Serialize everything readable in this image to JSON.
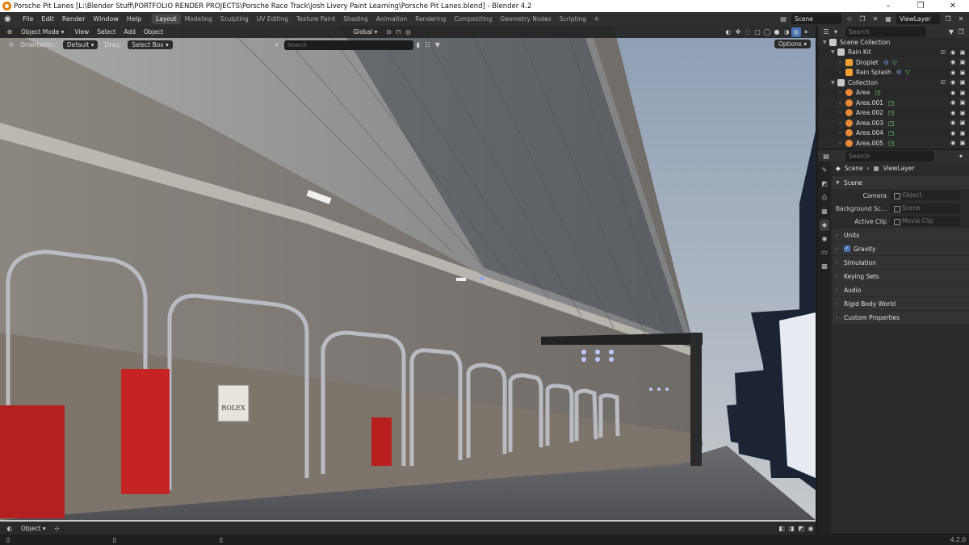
{
  "window": {
    "title": "Porsche Pit Lanes [L:\\Blender Stuff\\PORTFOLIO RENDER PROJECTS\\Porsche Race Track\\Josh Livery Paint Learning\\Porsche Pit Lanes.blend] - Blender 4.2",
    "minimize": "–",
    "maximize": "❐",
    "close": "✕"
  },
  "menu": [
    "File",
    "Edit",
    "Render",
    "Window",
    "Help"
  ],
  "workspaces": [
    {
      "label": "Layout",
      "active": true
    },
    {
      "label": "Modeling"
    },
    {
      "label": "Sculpting"
    },
    {
      "label": "UV Editing"
    },
    {
      "label": "Texture Paint"
    },
    {
      "label": "Shading"
    },
    {
      "label": "Animation"
    },
    {
      "label": "Rendering"
    },
    {
      "label": "Compositing"
    },
    {
      "label": "Geometry Nodes"
    },
    {
      "label": "Scripting"
    }
  ],
  "topbar_right": {
    "scene": "Scene",
    "view_layer": "ViewLayer"
  },
  "viewport": {
    "mode": "Object Mode",
    "menus": [
      "View",
      "Select",
      "Add",
      "Object"
    ],
    "transform_orientation": "Global",
    "orientation_label": "Orientation:",
    "orientation_value": "Default",
    "drag_label": "Drag:",
    "drag_value": "Select Box",
    "search_placeholder": "Search",
    "options": "Options"
  },
  "outliner": {
    "search_placeholder": "Search",
    "items": [
      {
        "name": "Scene Collection",
        "indent": 0,
        "icon": "collection-icon",
        "color": "#c8c8c8"
      },
      {
        "name": "Rain Kit",
        "indent": 1,
        "icon": "collection-icon",
        "color": "#c8c8c8",
        "checked": true
      },
      {
        "name": "Droplet",
        "indent": 2,
        "icon": "mesh-icon",
        "color": "#f0a030",
        "extra": true
      },
      {
        "name": "Rain Splash",
        "indent": 2,
        "icon": "mesh-icon",
        "color": "#f0a030",
        "extra": true
      },
      {
        "name": "Collection",
        "indent": 1,
        "icon": "collection-icon",
        "color": "#c8c8c8",
        "checked": true
      },
      {
        "name": "Area",
        "indent": 2,
        "icon": "light-icon",
        "color": "#e8893a",
        "data": true
      },
      {
        "name": "Area.001",
        "indent": 2,
        "icon": "light-icon",
        "color": "#e8893a",
        "data": true
      },
      {
        "name": "Area.002",
        "indent": 2,
        "icon": "light-icon",
        "color": "#e8893a",
        "data": true
      },
      {
        "name": "Area.003",
        "indent": 2,
        "icon": "light-icon",
        "color": "#e8893a",
        "data": true
      },
      {
        "name": "Area.004",
        "indent": 2,
        "icon": "light-icon",
        "color": "#e8893a",
        "data": true
      },
      {
        "name": "Area.005",
        "indent": 2,
        "icon": "light-icon",
        "color": "#e8893a",
        "data": true
      }
    ]
  },
  "properties": {
    "search_placeholder": "Search",
    "breadcrumb": {
      "scene": "Scene",
      "view_layer": "ViewLayer"
    },
    "scene_panel": "Scene",
    "fields": [
      {
        "label": "Camera",
        "placeholder": "Object"
      },
      {
        "label": "Background Sc...",
        "placeholder": "Scene"
      },
      {
        "label": "Active Clip",
        "placeholder": "Movie Clip"
      }
    ],
    "panels": [
      {
        "label": "Units"
      },
      {
        "label": "Gravity",
        "checkbox": true
      },
      {
        "label": "Simulation"
      },
      {
        "label": "Keying Sets"
      },
      {
        "label": "Audio"
      },
      {
        "label": "Rigid Body World"
      },
      {
        "label": "Custom Properties"
      }
    ]
  },
  "bottom": {
    "mode": "Object"
  },
  "status": {
    "version": "4.2.0"
  },
  "colors": {
    "accent": "#4772b3",
    "header": "#303030",
    "panel": "#2b2b2b"
  }
}
